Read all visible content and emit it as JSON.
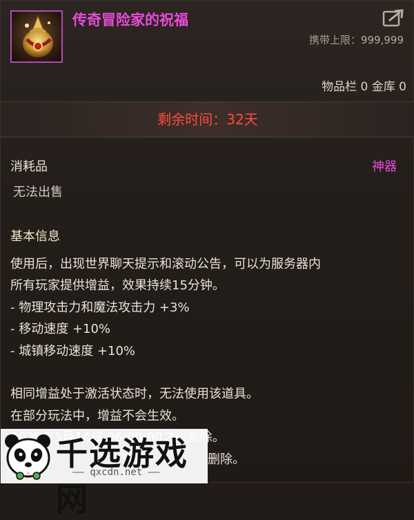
{
  "item": {
    "title": "传奇冒险家的祝福",
    "carry_label": "携带上限：",
    "carry_value": "999,999",
    "storage": "物品栏 0 金库 0",
    "remaining_time": "剩余时间：32天",
    "type": "消耗品",
    "rarity": "神器",
    "trade": "无法出售",
    "section_title": "基本信息",
    "description": [
      "使用后，出现世界聊天提示和滚动公告，可以为服务器内",
      "所有玩家提供增益，效果持续15分钟。",
      "- 物理攻击力和魔法攻击力 +3%",
      "- 移动速度 +10%",
      "- 城镇移动速度 +10%",
      "",
      "相同增益处于激活状态时，无法使用该道具。",
      "在部分玩法中，增益不会生效。",
      "2025年5月14日 06:00:00之后删除。",
      "删除。"
    ]
  },
  "watermark": {
    "text": "千选游戏网",
    "url": "—— qxcdn.net ——"
  },
  "colors": {
    "title": "#e84cd8",
    "time": "#ff4a3f",
    "rarity": "#e84cd8"
  },
  "icons": {
    "item": "legendary-blessing-icon",
    "share": "share-icon",
    "panda": "panda-logo-icon"
  }
}
